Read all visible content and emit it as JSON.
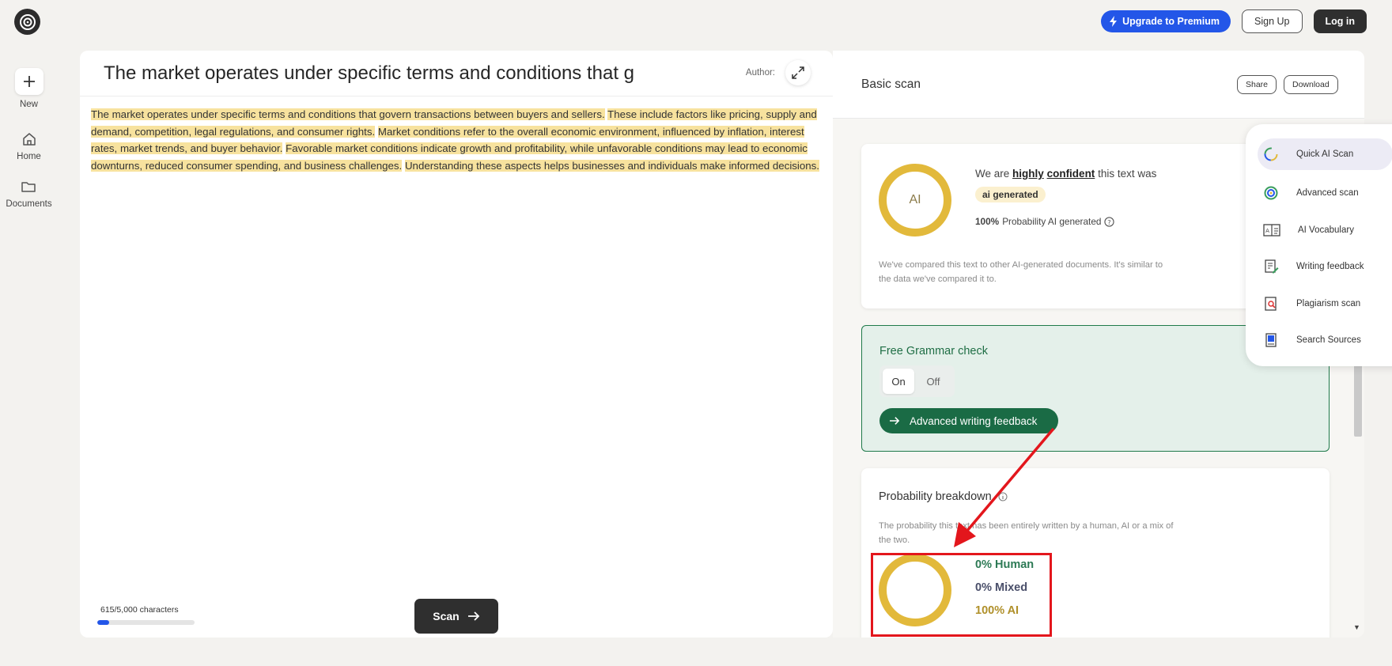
{
  "header": {
    "premium_label": "Upgrade to Premium",
    "signup_label": "Sign Up",
    "login_label": "Log in"
  },
  "sidebar": {
    "new_label": "New",
    "home_label": "Home",
    "documents_label": "Documents"
  },
  "editor": {
    "title": "The market operates under specific terms and conditions that g",
    "author_label": "Author:",
    "sentences": [
      "The market operates under specific terms and conditions that govern transactions between buyers and sellers.",
      "These include factors like pricing, supply and demand, competition, legal regulations, and consumer rights.",
      "Market conditions refer to the overall economic environment, influenced by inflation, interest rates, market trends, and buyer behavior.",
      "Favorable market conditions indicate growth and profitability, while unfavorable conditions may lead to economic downturns, reduced consumer spending, and business challenges.",
      "Understanding these aspects helps businesses and individuals make informed decisions."
    ],
    "char_count": "615/5,000 characters",
    "char_progress": 0.123,
    "scan_label": "Scan"
  },
  "result": {
    "title": "Basic scan",
    "share_label": "Share",
    "download_label": "Download",
    "summary": {
      "ring_label": "AI",
      "we_are": "We are",
      "highly": "highly",
      "confident": "confident",
      "this_text_was": "this text was",
      "badge": "ai generated",
      "probability_pct": "100%",
      "probability_text": "Probability AI generated",
      "note": "We've compared this text to other AI-generated documents. It's similar to the data we've compared it to."
    },
    "grammar": {
      "title": "Free Grammar check",
      "on_label": "On",
      "off_label": "Off",
      "feedback_label": "Advanced writing feedback"
    },
    "breakdown": {
      "title": "Probability breakdown",
      "description": "The probability this text has been entirely written by a human, AI or a mix of the two.",
      "human": "0% Human",
      "mixed": "0% Mixed",
      "ai": "100% AI"
    }
  },
  "menu": {
    "items": [
      {
        "label": "Quick AI Scan",
        "icon": "quick-scan-icon"
      },
      {
        "label": "Advanced scan",
        "icon": "advanced-scan-icon"
      },
      {
        "label": "AI Vocabulary",
        "icon": "vocabulary-icon"
      },
      {
        "label": "Writing feedback",
        "icon": "writing-feedback-icon"
      },
      {
        "label": "Plagiarism scan",
        "icon": "plagiarism-icon"
      },
      {
        "label": "Search Sources",
        "icon": "search-sources-icon"
      }
    ]
  },
  "colors": {
    "accent_blue": "#2356e8",
    "ai_gold": "#e2b93b",
    "grammar_green": "#1a6b45",
    "highlight": "#f7e29e",
    "annotation_red": "#e3161c"
  }
}
